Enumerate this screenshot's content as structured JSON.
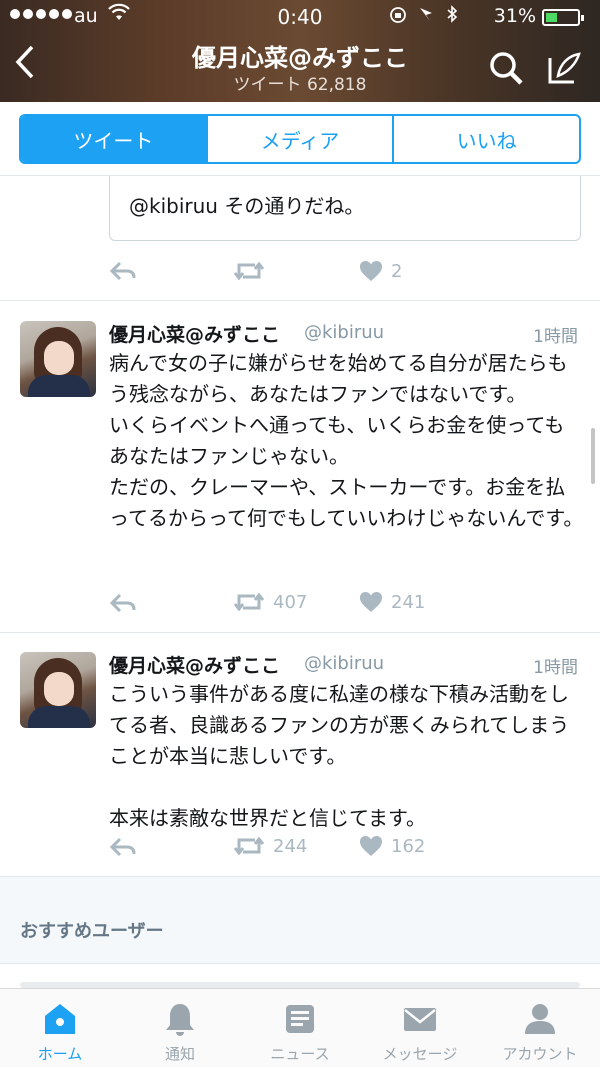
{
  "status_bar": {
    "carrier": "au",
    "time": "0:40",
    "battery_percent": "31%",
    "battery_level": 0.31
  },
  "header": {
    "title": "優月心菜@みずここ",
    "subtitle": "ツイート 62,818"
  },
  "tabs": [
    "ツイート",
    "メディア",
    "いいね"
  ],
  "quoted_tweet": {
    "text": "@kibiruu その通りだね。"
  },
  "first_actions": {
    "likes": "2"
  },
  "tweets": [
    {
      "name": "優月心菜@みずここ",
      "handle": "@kibiruu",
      "time": "1時間",
      "text": "病んで女の子に嫌がらせを始めてる自分が居たらもう残念ながら、あなたはファンではないです。\nいくらイベントへ通っても、いくらお金を使ってもあなたはファンじゃない。\nただの、クレーマーや、ストーカーです。お金を払ってるからって何でもしていいわけじゃないんです。",
      "retweets": "407",
      "likes": "241"
    },
    {
      "name": "優月心菜@みずここ",
      "handle": "@kibiruu",
      "time": "1時間",
      "text": "こういう事件がある度に私達の様な下積み活動をしてる者、良識あるファンの方が悪くみられてしまうことが本当に悲しいです。\n\n本来は素敵な世界だと信じてます。",
      "retweets": "244",
      "likes": "162"
    }
  ],
  "recommended": {
    "label": "おすすめユーザー"
  },
  "tab_bar": [
    "ホーム",
    "通知",
    "ニュース",
    "メッセージ",
    "アカウント"
  ],
  "colors": {
    "accent": "#1da1f2",
    "icon_gray": "#aab8c2"
  }
}
